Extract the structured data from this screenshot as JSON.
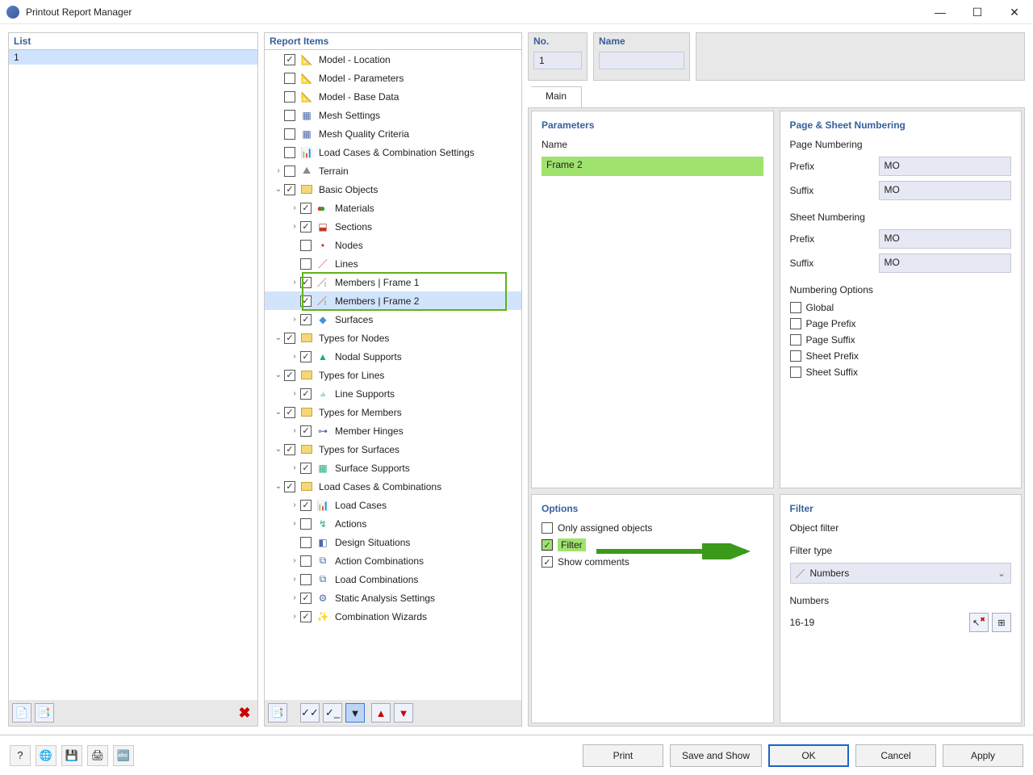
{
  "window": {
    "title": "Printout Report Manager"
  },
  "list": {
    "header": "List",
    "items": [
      "1"
    ]
  },
  "no": {
    "label": "No.",
    "value": "1"
  },
  "name": {
    "label": "Name",
    "value": ""
  },
  "reportItems": {
    "header": "Report Items",
    "tree": [
      {
        "level": 0,
        "caret": "",
        "checked": true,
        "icon": "model",
        "label": "Model - Location"
      },
      {
        "level": 0,
        "caret": "",
        "checked": false,
        "icon": "model",
        "label": "Model - Parameters"
      },
      {
        "level": 0,
        "caret": "",
        "checked": false,
        "icon": "model",
        "label": "Model - Base Data"
      },
      {
        "level": 0,
        "caret": "",
        "checked": false,
        "icon": "mesh",
        "label": "Mesh Settings"
      },
      {
        "level": 0,
        "caret": "",
        "checked": false,
        "icon": "mesh",
        "label": "Mesh Quality Criteria"
      },
      {
        "level": 0,
        "caret": "",
        "checked": false,
        "icon": "lc",
        "label": "Load Cases & Combination Settings"
      },
      {
        "level": 0,
        "caret": ">",
        "checked": false,
        "icon": "terrain",
        "label": "Terrain"
      },
      {
        "level": 0,
        "caret": "v",
        "checked": true,
        "icon": "folder",
        "label": "Basic Objects"
      },
      {
        "level": 1,
        "caret": ">",
        "checked": true,
        "icon": "materials",
        "label": "Materials"
      },
      {
        "level": 1,
        "caret": ">",
        "checked": true,
        "icon": "sections",
        "label": "Sections"
      },
      {
        "level": 1,
        "caret": "",
        "checked": false,
        "icon": "node",
        "label": "Nodes"
      },
      {
        "level": 1,
        "caret": "",
        "checked": false,
        "icon": "line",
        "label": "Lines"
      },
      {
        "level": 1,
        "caret": ">",
        "checked": true,
        "icon": "member",
        "label": "Members | Frame 1",
        "hl": true
      },
      {
        "level": 1,
        "caret": "",
        "checked": true,
        "icon": "member",
        "label": "Members | Frame 2",
        "hl": true,
        "sel": true
      },
      {
        "level": 1,
        "caret": ">",
        "checked": true,
        "icon": "surface",
        "label": "Surfaces"
      },
      {
        "level": 0,
        "caret": "v",
        "checked": true,
        "icon": "folder",
        "label": "Types for Nodes"
      },
      {
        "level": 1,
        "caret": ">",
        "checked": true,
        "icon": "support",
        "label": "Nodal Supports"
      },
      {
        "level": 0,
        "caret": "v",
        "checked": true,
        "icon": "folder",
        "label": "Types for Lines"
      },
      {
        "level": 1,
        "caret": ">",
        "checked": true,
        "icon": "lsupport",
        "label": "Line Supports"
      },
      {
        "level": 0,
        "caret": "v",
        "checked": true,
        "icon": "folder",
        "label": "Types for Members"
      },
      {
        "level": 1,
        "caret": ">",
        "checked": true,
        "icon": "hinge",
        "label": "Member Hinges"
      },
      {
        "level": 0,
        "caret": "v",
        "checked": true,
        "icon": "folder",
        "label": "Types for Surfaces"
      },
      {
        "level": 1,
        "caret": ">",
        "checked": true,
        "icon": "ssupport",
        "label": "Surface Supports"
      },
      {
        "level": 0,
        "caret": "v",
        "checked": true,
        "icon": "folder",
        "label": "Load Cases & Combinations"
      },
      {
        "level": 1,
        "caret": ">",
        "checked": true,
        "icon": "lc",
        "label": "Load Cases"
      },
      {
        "level": 1,
        "caret": ">",
        "checked": false,
        "icon": "action",
        "label": "Actions"
      },
      {
        "level": 1,
        "caret": "",
        "checked": false,
        "icon": "ds",
        "label": "Design Situations"
      },
      {
        "level": 1,
        "caret": ">",
        "checked": false,
        "icon": "ac",
        "label": "Action Combinations"
      },
      {
        "level": 1,
        "caret": ">",
        "checked": false,
        "icon": "lcomb",
        "label": "Load Combinations"
      },
      {
        "level": 1,
        "caret": ">",
        "checked": true,
        "icon": "sas",
        "label": "Static Analysis Settings"
      },
      {
        "level": 1,
        "caret": ">",
        "checked": true,
        "icon": "cw",
        "label": "Combination Wizards"
      }
    ]
  },
  "tabs": {
    "main": "Main"
  },
  "parameters": {
    "header": "Parameters",
    "nameLabel": "Name",
    "nameValue": "Frame 2"
  },
  "pageSheet": {
    "header": "Page & Sheet Numbering",
    "pageNumbering": "Page Numbering",
    "sheetNumbering": "Sheet Numbering",
    "prefixLabel": "Prefix",
    "suffixLabel": "Suffix",
    "pagePrefix": "MO",
    "pageSuffix": "MO",
    "sheetPrefix": "MO",
    "sheetSuffix": "MO",
    "numberingOptions": "Numbering Options",
    "opts": [
      "Global",
      "Page Prefix",
      "Page Suffix",
      "Sheet Prefix",
      "Sheet Suffix"
    ]
  },
  "options": {
    "header": "Options",
    "onlyAssigned": "Only assigned objects",
    "filter": "Filter",
    "showComments": "Show comments"
  },
  "filter": {
    "header": "Filter",
    "objectFilter": "Object filter",
    "filterType": "Filter type",
    "filterTypeValue": "Numbers",
    "numbersLabel": "Numbers",
    "numbersValue": "16-19"
  },
  "buttons": {
    "print": "Print",
    "saveShow": "Save and Show",
    "ok": "OK",
    "cancel": "Cancel",
    "apply": "Apply"
  }
}
